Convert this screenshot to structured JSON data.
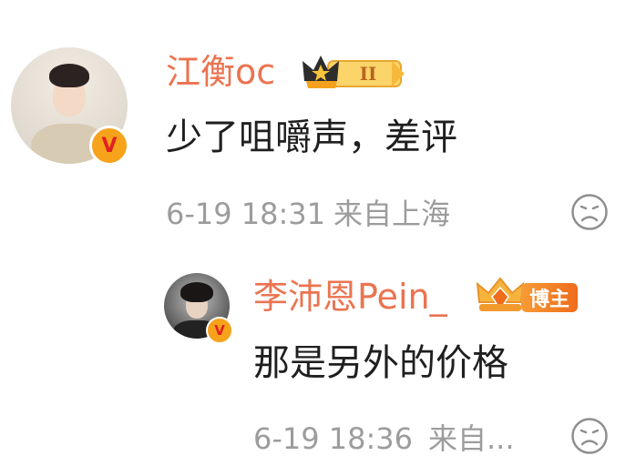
{
  "comments": [
    {
      "username": "江衡oc",
      "text": "少了咀嚼声，差评",
      "time": "6-19 18:31",
      "location": "来自上海",
      "badge_level": "II",
      "verified_mark": "V",
      "react_icon": "sad-face-icon"
    },
    {
      "username": "李沛恩Pein_",
      "text": "那是另外的价格",
      "time": "6-19 18:36",
      "location": "来自...",
      "role_tag": "博主",
      "verified_mark": "V",
      "react_icon": "sad-face-icon"
    }
  ],
  "colors": {
    "username": "#eb7350",
    "meta": "#9c9c9c",
    "text": "#1f1f1f",
    "badge_gold": "#f7a21b"
  }
}
